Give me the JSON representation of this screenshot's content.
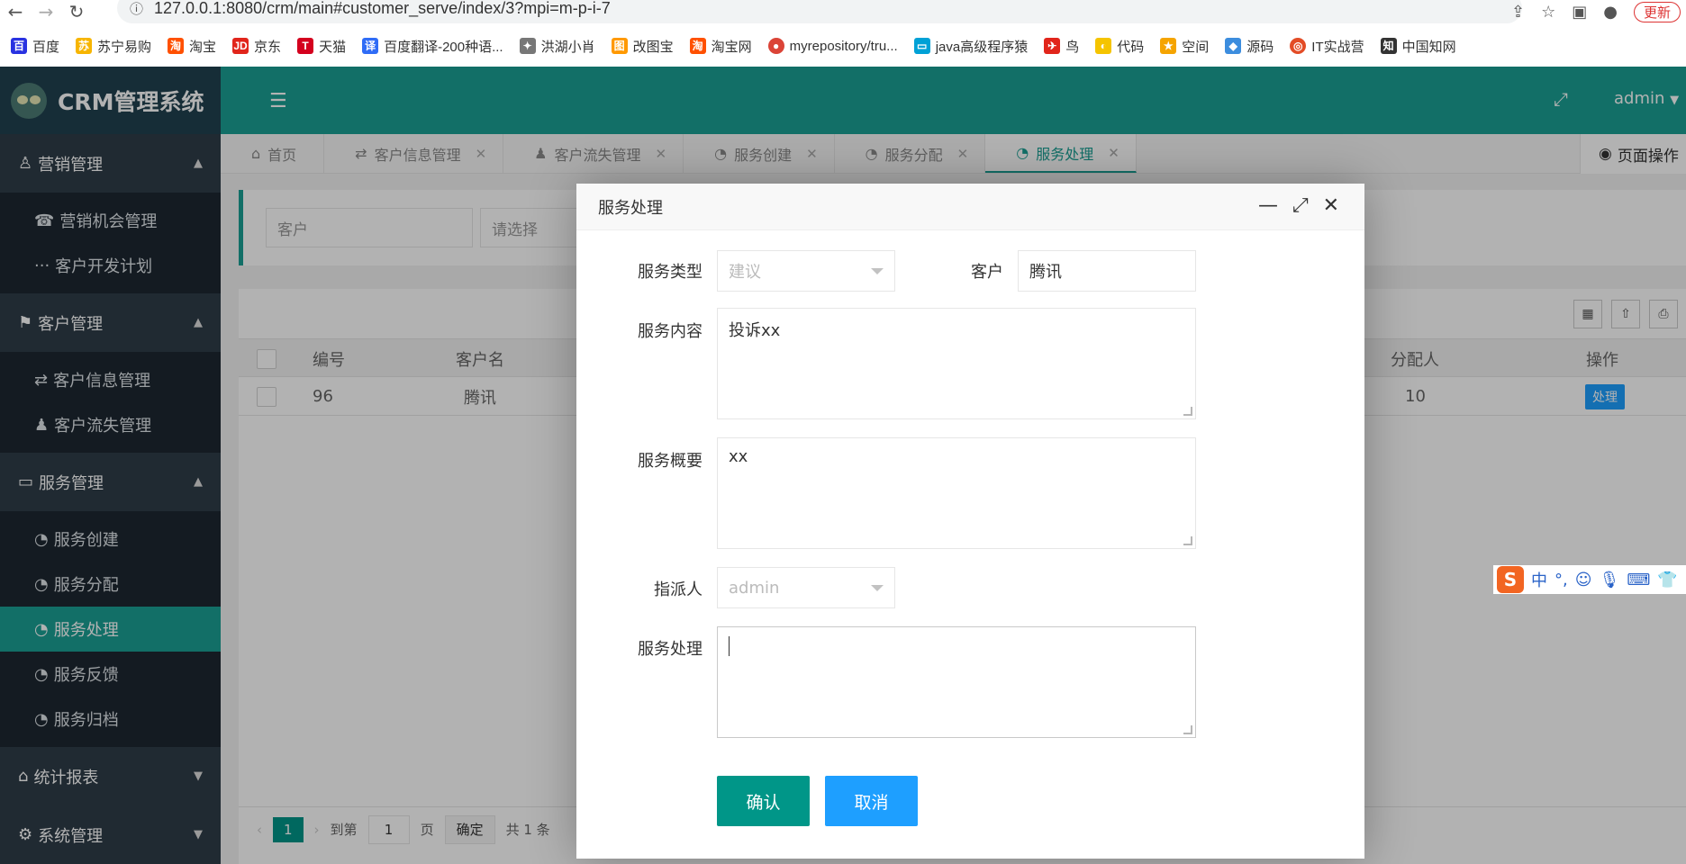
{
  "browser": {
    "url": "127.0.0.1:8080/crm/main#customer_serve/index/3?mpi=m-p-i-7",
    "update_label": "更新",
    "bookmarks": [
      {
        "label": "百度",
        "color": "#2932e1",
        "icon": "paw-icon"
      },
      {
        "label": "苏宁易购",
        "color": "#f7b500",
        "icon": "lion-icon"
      },
      {
        "label": "淘宝",
        "color": "#ff5000",
        "icon": "taobao-icon"
      },
      {
        "label": "京东",
        "color": "#e1251b",
        "icon": "jd-icon"
      },
      {
        "label": "天猫",
        "color": "#d4001e",
        "icon": "tmall-icon"
      },
      {
        "label": "百度翻译-200种语...",
        "color": "#2f6cf6",
        "icon": "translate-icon"
      },
      {
        "label": "洪湖小肖",
        "color": "#777777",
        "icon": "bird-icon"
      },
      {
        "label": "改图宝",
        "color": "#ff9900",
        "icon": "image-icon"
      },
      {
        "label": "淘宝网",
        "color": "#ff5000",
        "icon": "taobao-icon"
      },
      {
        "label": "myrepository/tru...",
        "color": "#db4437",
        "icon": "chrome-icon"
      },
      {
        "label": "java高级程序猿",
        "color": "#00a1d6",
        "icon": "bilibili-icon"
      },
      {
        "label": "鸟",
        "color": "#e1251b",
        "icon": "bird-icon"
      },
      {
        "label": "代码",
        "color": "#f5c400",
        "icon": "code-icon"
      },
      {
        "label": "空间",
        "color": "#f5a400",
        "icon": "qzone-icon"
      },
      {
        "label": "源码",
        "color": "#3c8dde",
        "icon": "fish-icon"
      },
      {
        "label": "IT实战营",
        "color": "#e34c26",
        "icon": "target-icon"
      },
      {
        "label": "中国知网",
        "color": "#333333",
        "icon": "cnki-icon"
      }
    ]
  },
  "app": {
    "title": "CRM管理系统",
    "admin": "admin",
    "page_ops": "页面操作"
  },
  "sidebar": {
    "groups": [
      {
        "label": "营销管理",
        "icon": "user-icon",
        "items": [
          "营销机会管理",
          "客户开发计划"
        ]
      },
      {
        "label": "客户管理",
        "icon": "flag-icon",
        "items": [
          "客户信息管理",
          "客户流失管理"
        ]
      },
      {
        "label": "服务管理",
        "icon": "monitor-icon",
        "items": [
          "服务创建",
          "服务分配",
          "服务处理",
          "服务反馈",
          "服务归档"
        ]
      }
    ],
    "bottom": [
      {
        "label": "统计报表",
        "icon": "home-icon"
      },
      {
        "label": "系统管理",
        "icon": "gears-icon"
      }
    ],
    "active_item": "服务处理"
  },
  "tabs": [
    "首页",
    "客户信息管理",
    "客户流失管理",
    "服务创建",
    "服务分配",
    "服务处理"
  ],
  "filter": {
    "customer_placeholder": "客户",
    "select_placeholder": "请选择"
  },
  "table": {
    "columns": [
      "编号",
      "客户名",
      "分配人",
      "操作"
    ],
    "row": {
      "id": "96",
      "customer": "腾讯",
      "assigner": "10",
      "action": "处理"
    }
  },
  "pager": {
    "current": "1",
    "goto_label": "到第",
    "goto_value": "1",
    "page_label": "页",
    "confirm": "确定",
    "total": "共 1 条"
  },
  "dialog": {
    "title": "服务处理",
    "fields": {
      "service_type_label": "服务类型",
      "service_type_value": "建议",
      "customer_label": "客户",
      "customer_value": "腾讯",
      "content_label": "服务内容",
      "content_value": "投诉xx",
      "summary_label": "服务概要",
      "summary_value": "xx",
      "assignee_label": "指派人",
      "assignee_value": "admin",
      "handling_label": "服务处理",
      "handling_value": ""
    },
    "confirm_label": "确认",
    "cancel_label": "取消"
  }
}
